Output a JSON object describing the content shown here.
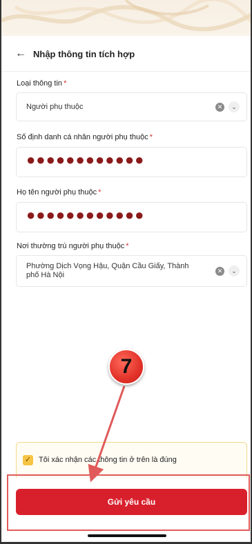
{
  "header": {
    "back_icon": "arrow-left-icon",
    "title": "Nhập thông tin tích hợp"
  },
  "form": {
    "info_type": {
      "label": "Loại thông tin",
      "required_mark": "*",
      "value": "Người phụ thuộc"
    },
    "id_number": {
      "label": "Số định danh cá nhân người phụ thuộc",
      "required_mark": "*",
      "value": "●●●●●●●●●●●●"
    },
    "full_name": {
      "label": "Họ tên người phụ thuộc",
      "required_mark": "*",
      "value": "●●●●●●●●●●●●"
    },
    "residence": {
      "label": "Nơi thường trú người phụ thuộc",
      "required_mark": "*",
      "value": "Phường Dịch Vọng Hậu, Quận Cầu Giấy, Thành phố Hà Nội"
    }
  },
  "confirm": {
    "checked": true,
    "text": "Tôi xác nhận các thông tin ở trên là đúng"
  },
  "submit": {
    "label": "Gửi yêu cầu"
  },
  "annotation": {
    "step_number": "7"
  },
  "colors": {
    "accent_red": "#d8202c",
    "checkbox_yellow": "#f6c544",
    "masked_dots": "#8b1a1a",
    "annotation_red": "#e05a5a"
  }
}
